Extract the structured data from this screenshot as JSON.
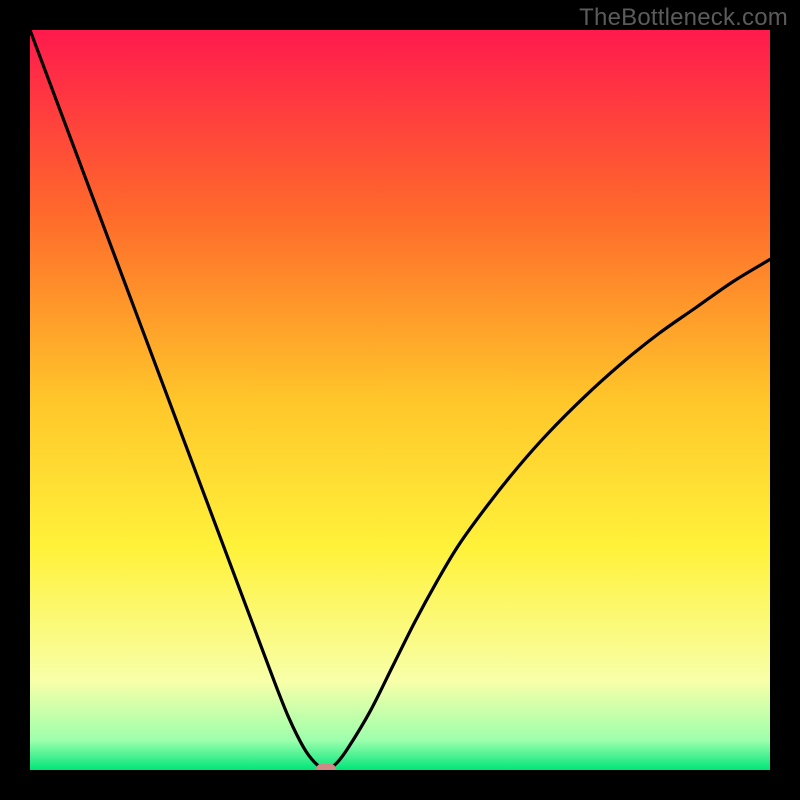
{
  "watermark": "TheBottleneck.com",
  "chart_data": {
    "type": "line",
    "title": "",
    "xlabel": "",
    "ylabel": "",
    "xlim": [
      0,
      100
    ],
    "ylim": [
      0,
      100
    ],
    "x": [
      0,
      3,
      6,
      9,
      12,
      15,
      18,
      21,
      24,
      27,
      30,
      33,
      35,
      37,
      38.5,
      40,
      41.5,
      43,
      46,
      49,
      52,
      55,
      58,
      62,
      66,
      70,
      75,
      80,
      85,
      90,
      95,
      100
    ],
    "y": [
      100,
      92,
      84,
      76,
      68,
      60,
      52,
      44,
      36,
      28,
      20,
      12,
      7,
      3,
      1,
      0,
      1,
      3,
      8,
      14,
      20,
      25.5,
      30.5,
      36,
      41,
      45.5,
      50.5,
      55,
      59,
      62.5,
      66,
      69
    ],
    "trough_marker": {
      "x": 40,
      "y": 0
    },
    "background": {
      "type": "gradient",
      "stops": [
        {
          "y_pct": 0,
          "color": "#ff1a4d"
        },
        {
          "y_pct": 25,
          "color": "#ff6a2b"
        },
        {
          "y_pct": 50,
          "color": "#ffc62a"
        },
        {
          "y_pct": 70,
          "color": "#fff23a"
        },
        {
          "y_pct": 88,
          "color": "#f8ffa8"
        },
        {
          "y_pct": 96,
          "color": "#9dffac"
        },
        {
          "y_pct": 100,
          "color": "#00e57a"
        }
      ]
    }
  }
}
